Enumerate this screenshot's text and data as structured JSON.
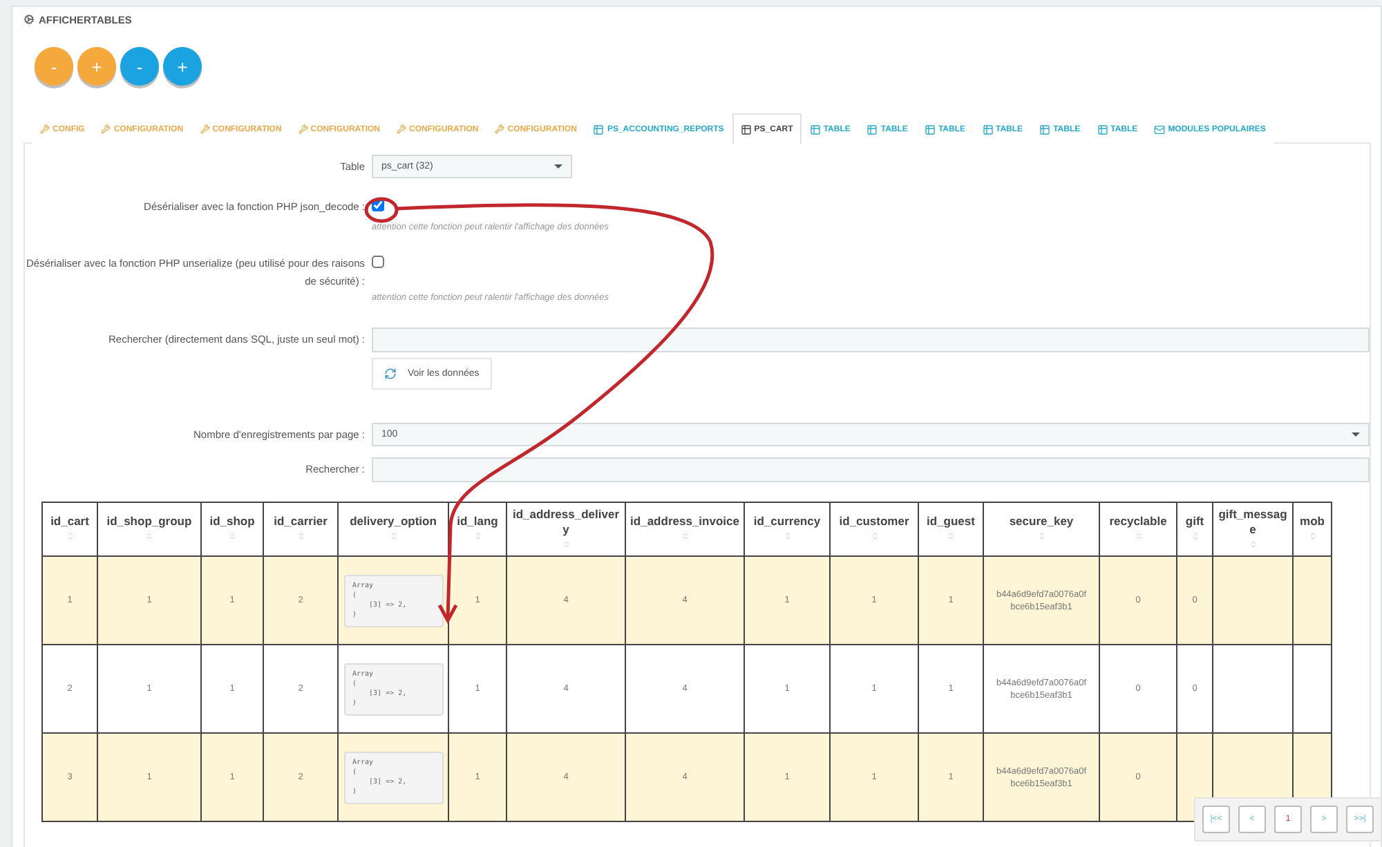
{
  "header": {
    "title": "AFFICHERTABLES"
  },
  "zoom_buttons": [
    {
      "label": "-",
      "color": "#f5a93c"
    },
    {
      "label": "+",
      "color": "#f5a93c"
    },
    {
      "label": "-",
      "color": "#1aa3e0"
    },
    {
      "label": "+",
      "color": "#1aa3e0"
    }
  ],
  "tabs": [
    {
      "label": "CONFIG",
      "kind": "wrench",
      "selected": false
    },
    {
      "label": "CONFIGURATION",
      "kind": "wrench",
      "selected": false
    },
    {
      "label": "CONFIGURATION",
      "kind": "wrench",
      "selected": false
    },
    {
      "label": "CONFIGURATION",
      "kind": "wrench",
      "selected": false
    },
    {
      "label": "CONFIGURATION",
      "kind": "wrench",
      "selected": false
    },
    {
      "label": "CONFIGURATION",
      "kind": "wrench",
      "selected": false
    },
    {
      "label": "PS_ACCOUNTING_REPORTS",
      "kind": "table",
      "selected": false
    },
    {
      "label": "PS_CART",
      "kind": "table",
      "selected": true
    },
    {
      "label": "TABLE",
      "kind": "table",
      "selected": false
    },
    {
      "label": "TABLE",
      "kind": "table",
      "selected": false
    },
    {
      "label": "TABLE",
      "kind": "table",
      "selected": false
    },
    {
      "label": "TABLE",
      "kind": "table",
      "selected": false
    },
    {
      "label": "TABLE",
      "kind": "table",
      "selected": false
    },
    {
      "label": "TABLE",
      "kind": "table",
      "selected": false
    },
    {
      "label": "MODULES POPULAIRES",
      "kind": "mail",
      "selected": false
    }
  ],
  "form": [
    {
      "kind": "select",
      "label": "Table",
      "value": "ps_cart (32)"
    },
    {
      "kind": "checkbox",
      "label": "Désérialiser avec la fonction PHP json_decode :",
      "checked": true,
      "circled": true,
      "hint": "attention cette fonction peut ralentir l'affichage des données"
    },
    {
      "kind": "checkbox",
      "label": "Désérialiser avec la fonction PHP unserialize (peu utilisé pour des raisons de sécurité) :",
      "checked": false,
      "circled": false,
      "hint": "attention cette fonction peut ralentir l'affichage des données"
    },
    {
      "kind": "search",
      "label": "Rechercher (directement dans SQL, juste un seul mot) :",
      "button": "Voir les données"
    },
    {
      "kind": "select",
      "label": "Nombre d'enregistrements par page :",
      "value": "100"
    },
    {
      "kind": "text",
      "label": "Rechercher :"
    }
  ],
  "table": {
    "columns": [
      "id_cart",
      "id_shop_group",
      "id_shop",
      "id_carrier",
      "delivery_option",
      "id_lang",
      "id_address_delivery",
      "id_address_invoice",
      "id_currency",
      "id_customer",
      "id_guest",
      "secure_key",
      "recyclable",
      "gift",
      "gift_message",
      "mob"
    ],
    "rows": [
      [
        "1",
        "1",
        "1",
        "2",
        "Array\n(\n    [3] => 2,\n)",
        "1",
        "4",
        "4",
        "1",
        "1",
        "1",
        "b44a6d9efd7a0076a0f bce6b15eaf3b1",
        "0",
        "0",
        "",
        ""
      ],
      [
        "2",
        "1",
        "1",
        "2",
        "Array\n(\n    [3] => 2,\n)",
        "1",
        "4",
        "4",
        "1",
        "1",
        "1",
        "b44a6d9efd7a0076a0f bce6b15eaf3b1",
        "0",
        "0",
        "",
        ""
      ],
      [
        "3",
        "1",
        "1",
        "2",
        "Array\n(\n    [3] => 2,\n)",
        "1",
        "4",
        "4",
        "1",
        "1",
        "1",
        "b44a6d9efd7a0076a0f bce6b15eaf3b1",
        "0",
        "",
        ""
      ]
    ]
  },
  "pagination": [
    {
      "label": "|<<",
      "selected": false
    },
    {
      "label": "<",
      "selected": false
    },
    {
      "label": "1",
      "selected": true
    },
    {
      "label": ">",
      "selected": false
    },
    {
      "label": ">>|",
      "selected": false
    }
  ]
}
